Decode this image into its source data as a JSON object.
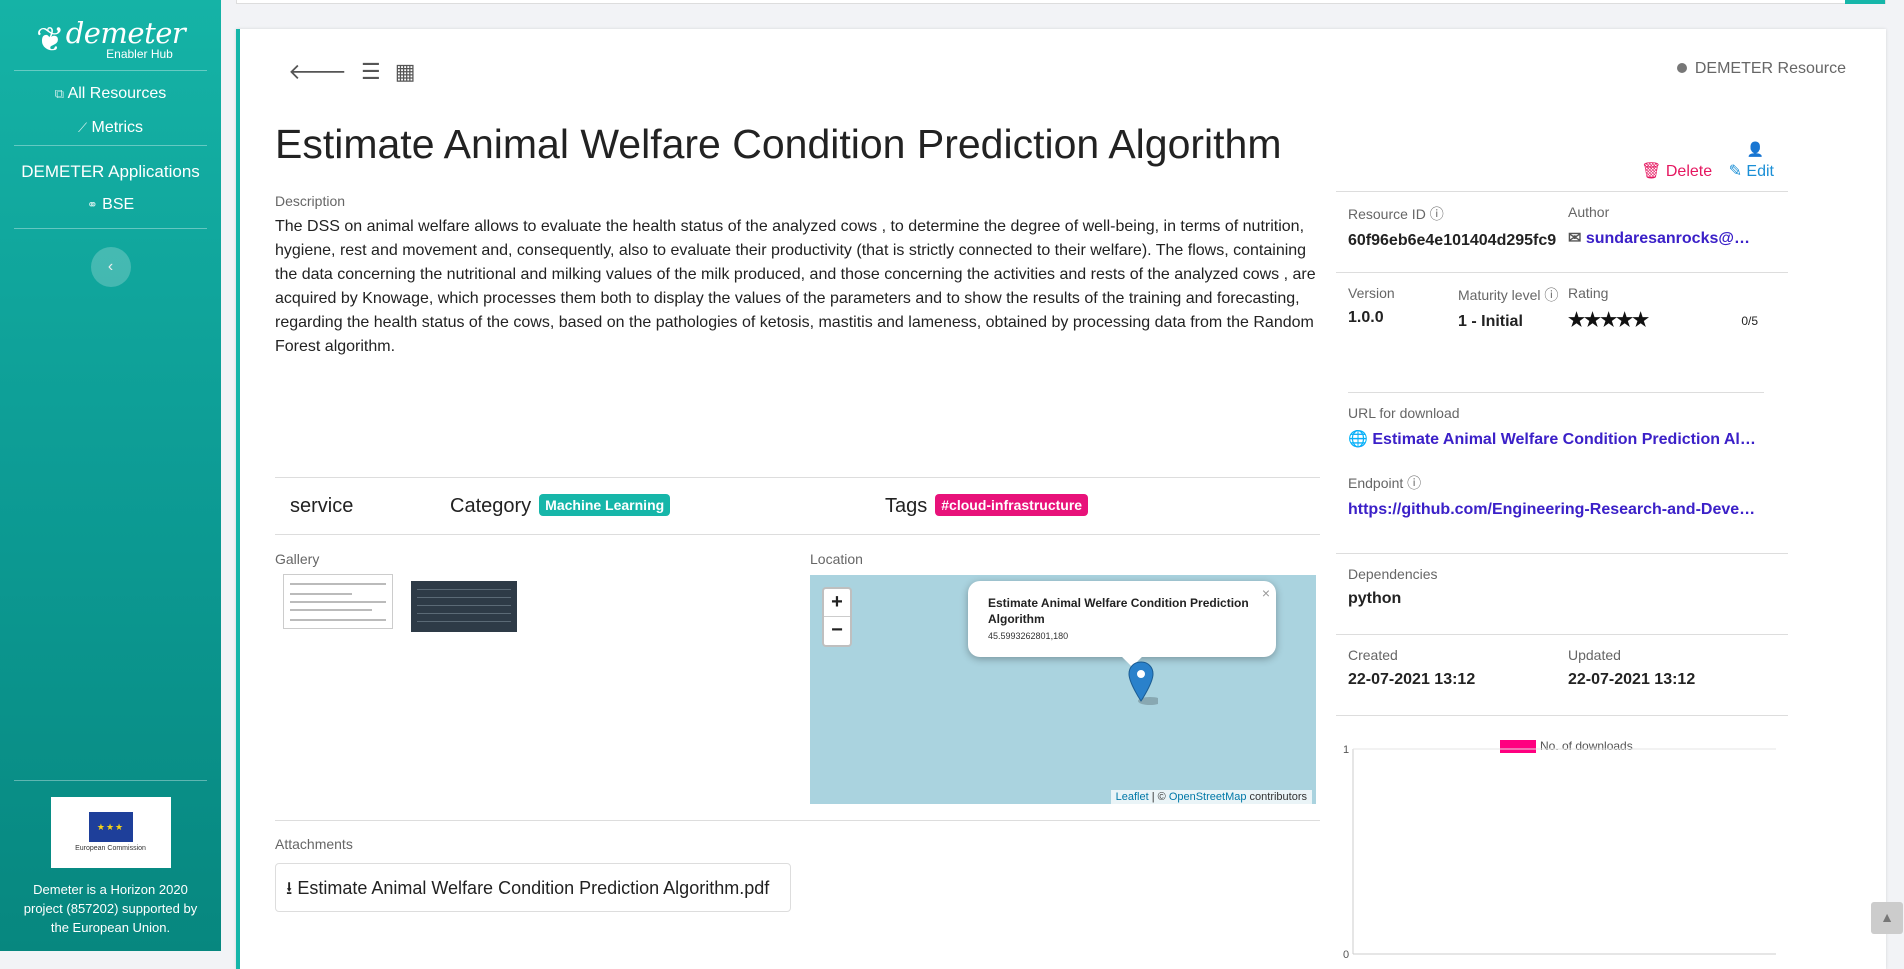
{
  "sidebar": {
    "logo_text": "demeter",
    "logo_sub": "Enabler Hub",
    "items": [
      {
        "label": "All Resources",
        "icon": "resources-icon"
      },
      {
        "label": "Metrics",
        "icon": "chart-line-icon"
      }
    ],
    "section_title": "DEMETER Applications",
    "app_items": [
      {
        "label": "BSE",
        "icon": "link-icon"
      }
    ],
    "collapse_icon": "‹",
    "eu_logo_text": "European Commission",
    "footer_text": "Demeter is a Horizon 2020 project (857202) supported by the European Union."
  },
  "resource": {
    "type_label": "DEMETER Resource",
    "title": "Estimate Animal Welfare Condition Prediction Algorithm",
    "description_label": "Description",
    "description": "The DSS on animal welfare allows to evaluate the health status of the analyzed cows , to determine the degree of well-being, in terms of nutrition, hygiene, rest and movement and, consequently, also to evaluate their productivity (that is strictly connected to their welfare). The flows, containing the data concerning the nutritional and milking values of the milk produced, and those concerning the activities and rests of the analyzed cows , are acquired by Knowage, which processes them both to display the values of the parameters and to show the results of the training and forecasting, regarding the health status of the cows, based on the pathologies of ketosis, mastitis and lameness, obtained by processing data from the Random Forest algorithm.",
    "kind": "service",
    "category_label": "Category",
    "category": "Machine Learning",
    "tags_label": "Tags",
    "tags": [
      "#cloud-infrastructure"
    ],
    "gallery_label": "Gallery",
    "location_label": "Location",
    "map": {
      "zoom_in": "+",
      "zoom_out": "−",
      "popup_title": "Estimate Animal Welfare Condition Prediction Algorithm",
      "popup_coords": "45.5993262801,180",
      "popup_close": "×",
      "attribution_leaflet": "Leaflet",
      "attribution_sep": " | © ",
      "attribution_osm": "OpenStreetMap",
      "attribution_suffix": " contributors"
    },
    "attachments_label": "Attachments",
    "attachment": "Estimate Animal Welfare Condition Prediction Algorithm.pdf"
  },
  "actions": {
    "delete": "Delete",
    "edit": "Edit"
  },
  "details": {
    "resource_id_label": "Resource ID",
    "resource_id": "60f96eb6e4e101404d295fc9",
    "author_label": "Author",
    "author": "sundaresanrocks@gmail.com",
    "version_label": "Version",
    "version": "1.0.0",
    "maturity_label": "Maturity level",
    "maturity": "1 - Initial",
    "rating_label": "Rating",
    "rating_value": 0,
    "rating_max": 5,
    "rating_text": "0/5",
    "url_label": "URL for download",
    "url_text": "Estimate Animal Welfare Condition Prediction Algorithm",
    "endpoint_label": "Endpoint",
    "endpoint": "https://github.com/Engineering-Research-and-Development/demeter-animal-welfare",
    "dependencies_label": "Dependencies",
    "dependencies": "python",
    "created_label": "Created",
    "created": "22-07-2021 13:12",
    "updated_label": "Updated",
    "updated": "22-07-2021 13:12"
  },
  "chart_data": {
    "type": "line",
    "series": [
      {
        "name": "No. of downloads",
        "values": []
      }
    ],
    "x": [],
    "ylim": [
      0,
      1
    ],
    "yticks": [
      "1",
      "0"
    ],
    "color": "#ff0080"
  },
  "colors": {
    "accent": "#16b6a9",
    "pink": "#e8127a",
    "link": "#3b20c8"
  }
}
